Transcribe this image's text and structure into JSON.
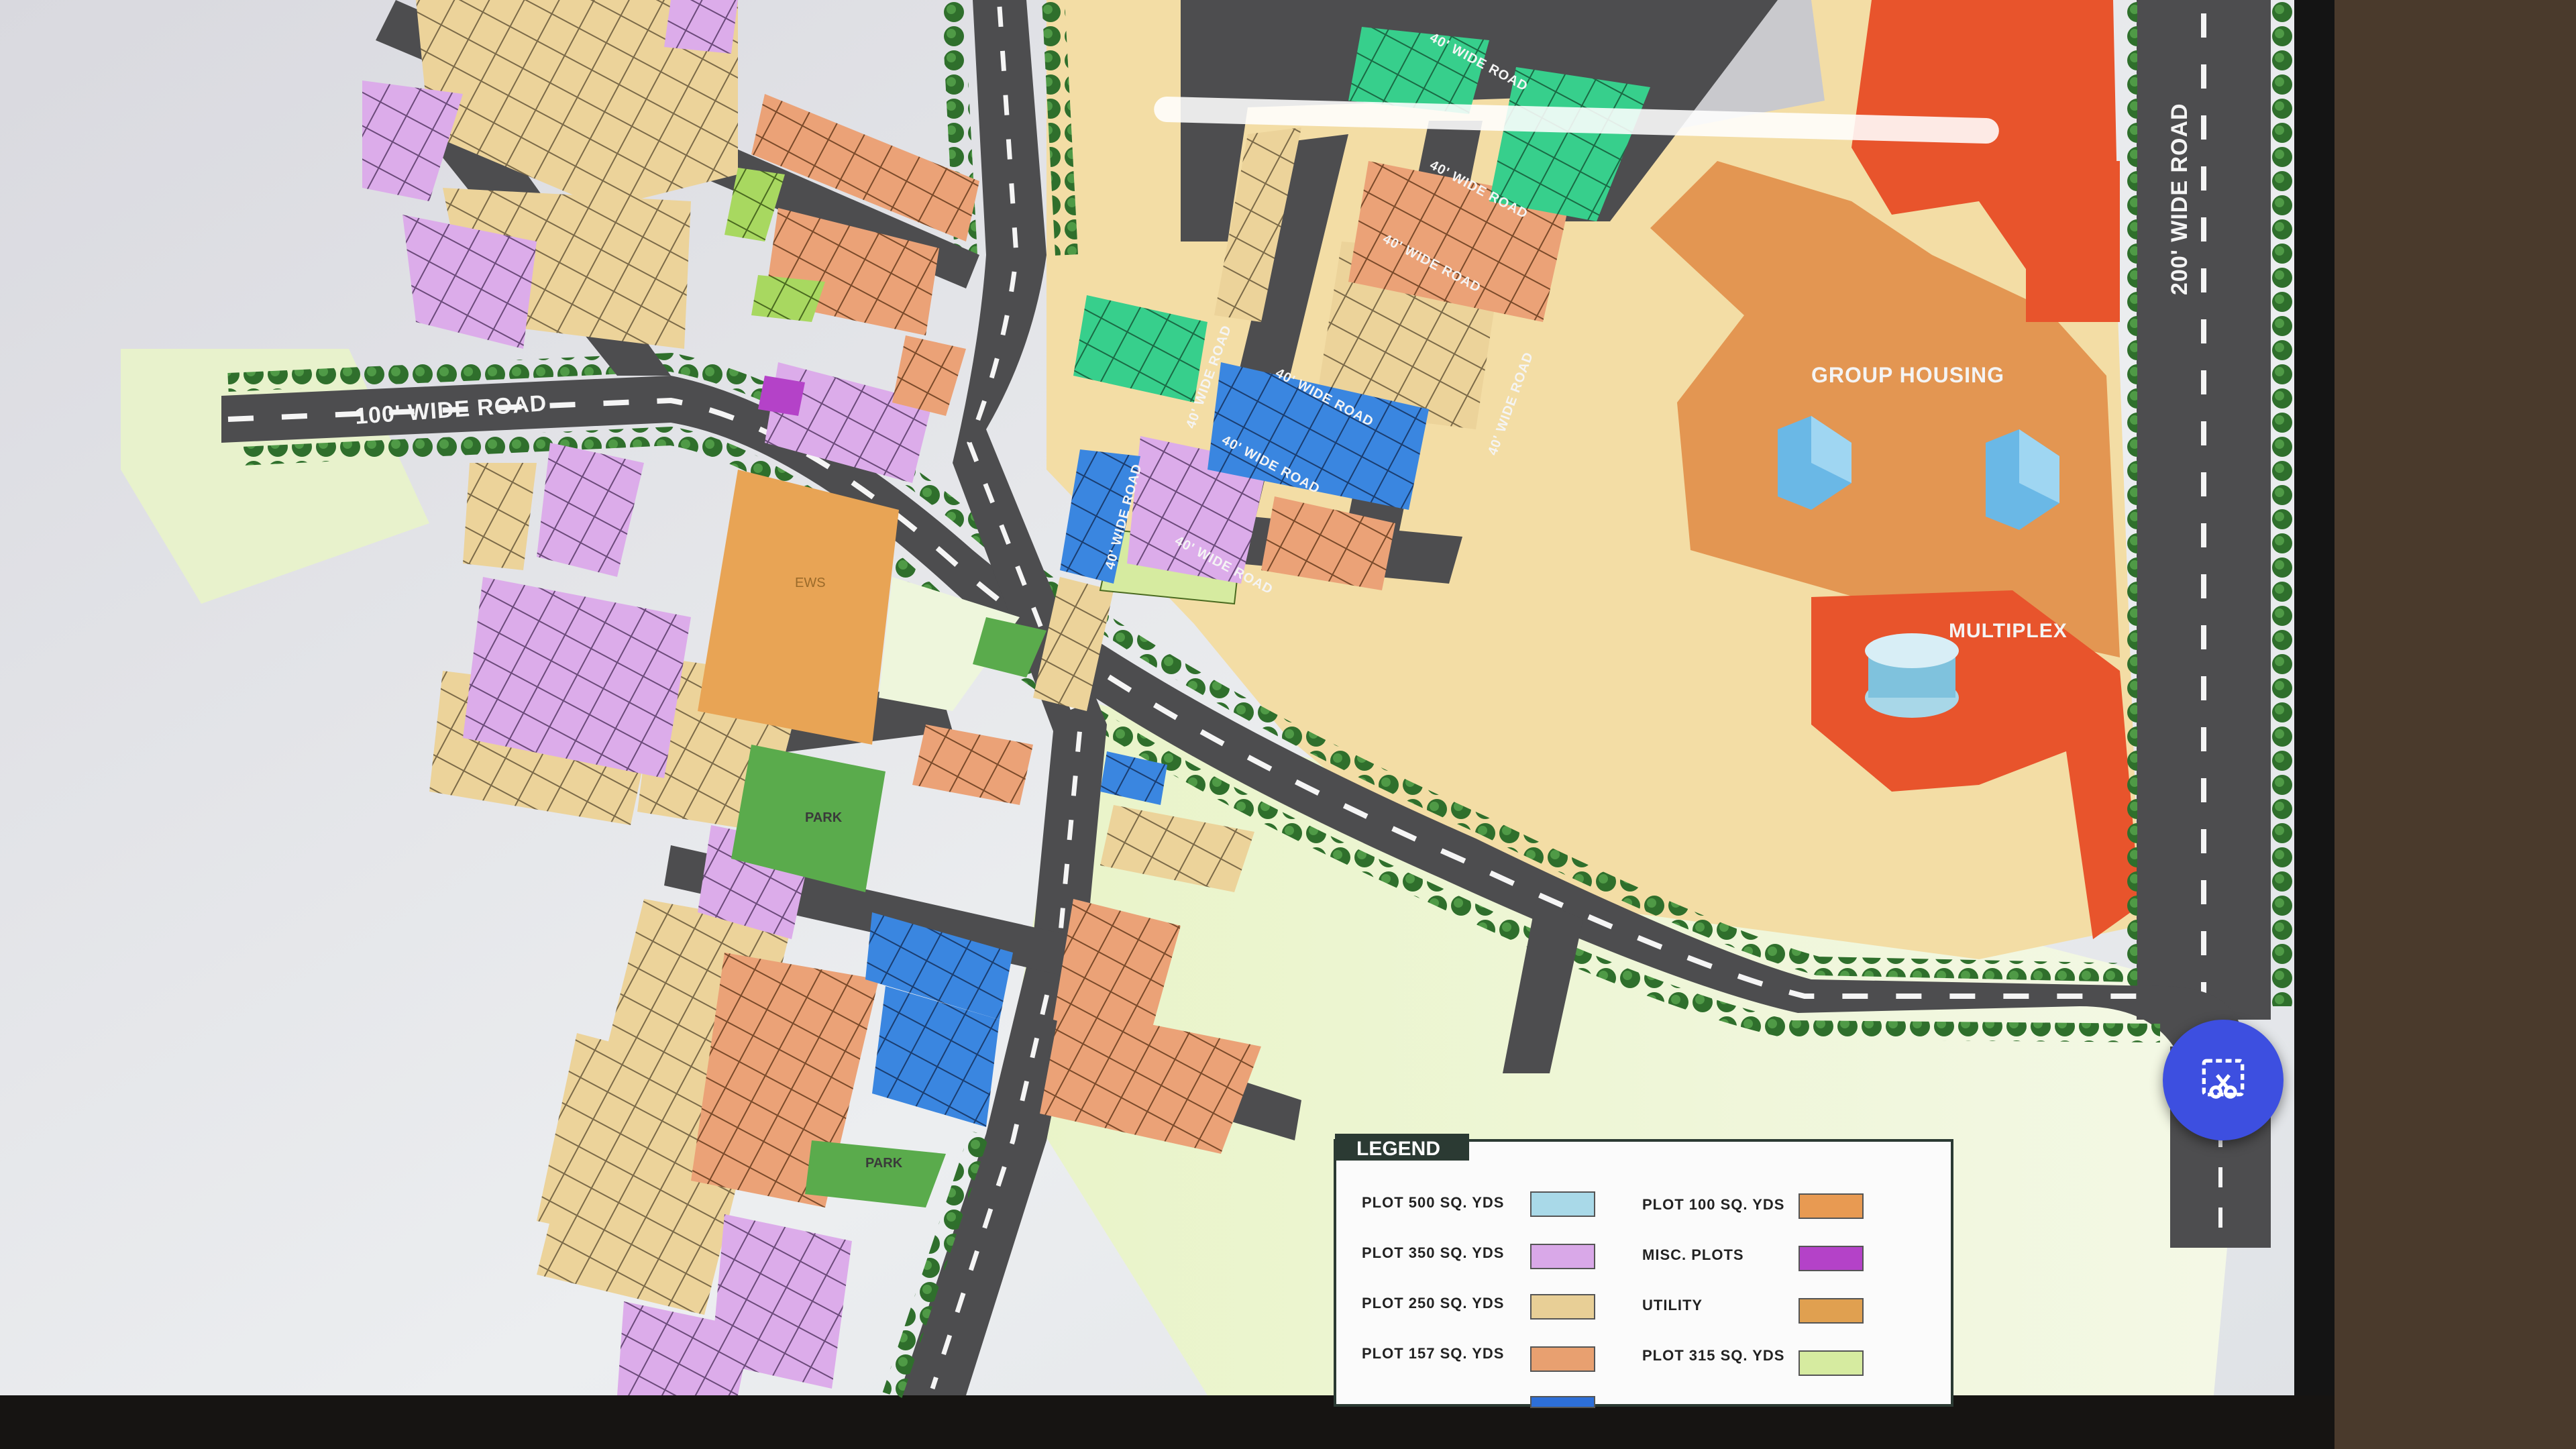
{
  "map": {
    "roads": {
      "main_left": "100' WIDE ROAD",
      "main_right": "200' WIDE ROAD",
      "internal": "40' WIDE ROAD"
    },
    "zones": {
      "group_housing": "GROUP HOUSING",
      "multiplex": "MULTIPLEX",
      "park": "PARK",
      "ews": "EWS"
    }
  },
  "legend": {
    "title": "LEGEND",
    "items": [
      {
        "label": "PLOT 500 SQ. YDS",
        "color": "#a9d9e8"
      },
      {
        "label": "PLOT 100 SQ. YDS",
        "color": "#e89a52"
      },
      {
        "label": "PLOT 350 SQ. YDS",
        "color": "#d9a8e8"
      },
      {
        "label": "MISC. PLOTS",
        "color": "#b442c8"
      },
      {
        "label": "PLOT 250 SQ. YDS",
        "color": "#e8cf96"
      },
      {
        "label": "UTILITY",
        "color": "#e0a050"
      },
      {
        "label": "PLOT 157 SQ. YDS",
        "color": "#e8a070"
      },
      {
        "label": "PLOT 315 SQ. YDS",
        "color": "#d6eba0"
      },
      {
        "label": "",
        "color": "#2d6fd8"
      }
    ]
  },
  "colors": {
    "road": "#4a4a4a",
    "group_housing": "#e0914a",
    "multiplex": "#e8542c",
    "open_land": "#f2dca0",
    "green": "#4caa46",
    "fab": "#3d4fe0"
  },
  "screen_capture_button": {
    "icon": "screenshot-capture-icon"
  }
}
